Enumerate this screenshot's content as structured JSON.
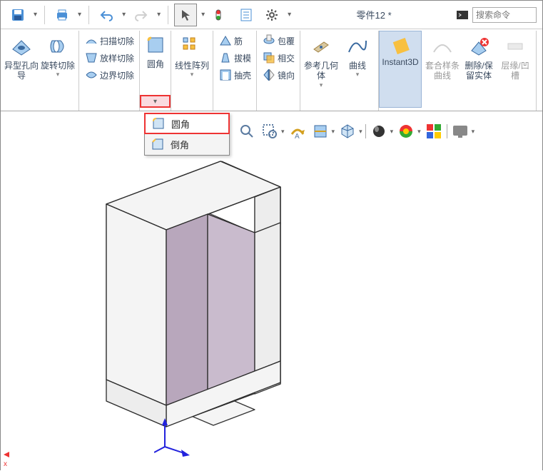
{
  "title": "零件12 *",
  "search": {
    "placeholder": "搜索命令"
  },
  "ribbon": {
    "col1": {
      "a": "异型孔向导",
      "b": "旋转切除"
    },
    "col2": {
      "a": "扫描切除",
      "b": "放样切除",
      "c": "边界切除"
    },
    "fillet": "圆角",
    "pattern": "线性阵列",
    "col3": {
      "a": "筋",
      "b": "拔模",
      "c": "抽壳"
    },
    "col4": {
      "a": "包覆",
      "b": "相交",
      "c": "镜向"
    },
    "refgeom": "参考几何体",
    "curve": "曲线",
    "instant3d": "Instant3D",
    "combine": "套合样条曲线",
    "delete": "删除/保留实体",
    "edge": "层缘/凹槽"
  },
  "dropdown": {
    "fillet": "圆角",
    "chamfer": "倒角"
  },
  "axis": {
    "x": "x"
  }
}
